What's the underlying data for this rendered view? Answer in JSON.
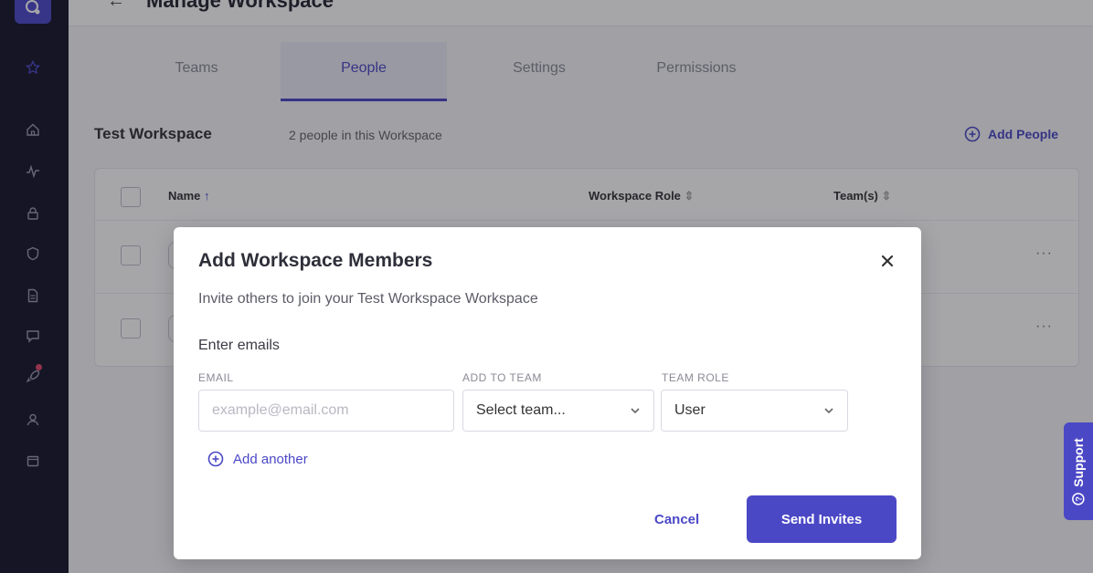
{
  "header": {
    "title": "Manage Workspace"
  },
  "tabs": [
    {
      "label": "Teams"
    },
    {
      "label": "People"
    },
    {
      "label": "Settings"
    },
    {
      "label": "Permissions"
    }
  ],
  "active_tab": "People",
  "workspace": {
    "name": "Test Workspace",
    "count_text": "2 people in this Workspace",
    "add_people_label": "Add People"
  },
  "table": {
    "columns": [
      "Name",
      "Workspace Role",
      "Team(s)"
    ],
    "row_count": 2
  },
  "modal": {
    "title": "Add Workspace Members",
    "subtitle": "Invite others to join your Test Workspace Workspace",
    "section_label": "Enter emails",
    "email_label": "EMAIL",
    "email_placeholder": "example@email.com",
    "team_label": "ADD TO TEAM",
    "team_value": "Select team...",
    "role_label": "TEAM ROLE",
    "role_value": "User",
    "add_another_label": "Add another",
    "cancel_label": "Cancel",
    "send_label": "Send Invites"
  },
  "support_label": "Support",
  "colors": {
    "accent": "#4b48c6",
    "sidebar": "#15162b",
    "notification": "#e0466b"
  }
}
